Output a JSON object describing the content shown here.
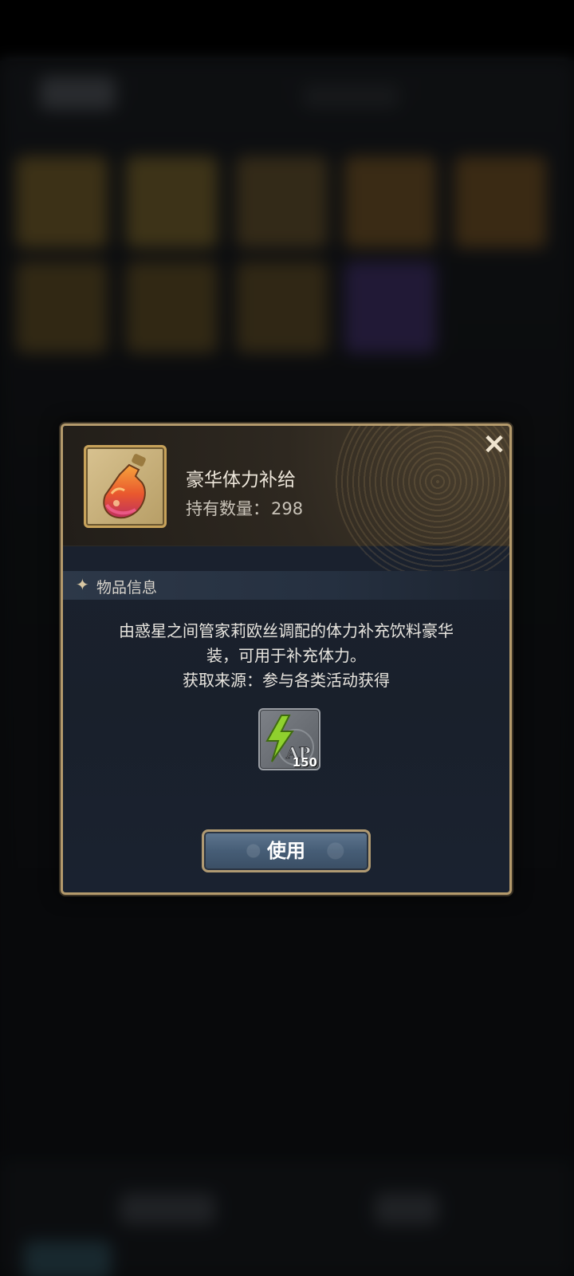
{
  "item": {
    "name": "豪华体力补给",
    "count_label": "持有数量：",
    "count_value": "298"
  },
  "section": {
    "title": "物品信息"
  },
  "description": {
    "line1": "由惑星之间管家莉欧丝调配的体力补充饮料豪华",
    "line2": "装，可用于补充体力。",
    "line3": "获取来源：参与各类活动获得"
  },
  "reward": {
    "icon": "ap-lightning-icon",
    "label": "AP",
    "amount": "150"
  },
  "buttons": {
    "use_label": "使用",
    "close_icon": "close-icon"
  },
  "colors": {
    "frame_gold": "#b49a6c",
    "button_blue": "#465d76",
    "lightning_green": "#8fd12e"
  }
}
